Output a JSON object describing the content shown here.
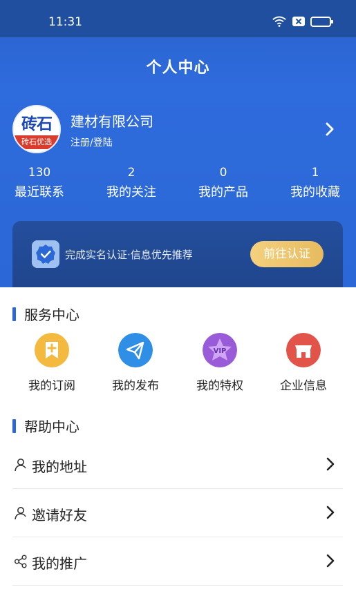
{
  "status": {
    "time": "11:31"
  },
  "header": {
    "title": "个人中心",
    "company_name": "建材有限公司",
    "login_text": "注册/登陆",
    "avatar_text": "砖石",
    "avatar_band_text": "砖石优选"
  },
  "stats": [
    {
      "value": "130",
      "label": "最近联系"
    },
    {
      "value": "2",
      "label": "我的关注"
    },
    {
      "value": "0",
      "label": "我的产品"
    },
    {
      "value": "1",
      "label": "我的收藏"
    }
  ],
  "verify": {
    "text": "完成实名认证·信息优先推荐",
    "button": "前往认证"
  },
  "services": {
    "title": "服务中心",
    "items": [
      {
        "label": "我的订阅",
        "icon": "subscription-icon",
        "color": "#f4b93f"
      },
      {
        "label": "我的发布",
        "icon": "paper-plane-icon",
        "color": "#2f8ee6"
      },
      {
        "label": "我的特权",
        "icon": "vip-star-icon",
        "color": "#9a5bd9"
      },
      {
        "label": "企业信息",
        "icon": "storefront-icon",
        "color": "#e2544a"
      }
    ]
  },
  "help": {
    "title": "帮助中心",
    "items": [
      {
        "label": "我的地址",
        "icon": "user-icon"
      },
      {
        "label": "邀请好友",
        "icon": "user-icon"
      },
      {
        "label": "我的推广",
        "icon": "share-icon"
      }
    ]
  },
  "colors": {
    "primary": "#2b67d6",
    "accent_gold": "#e7bb5f"
  }
}
